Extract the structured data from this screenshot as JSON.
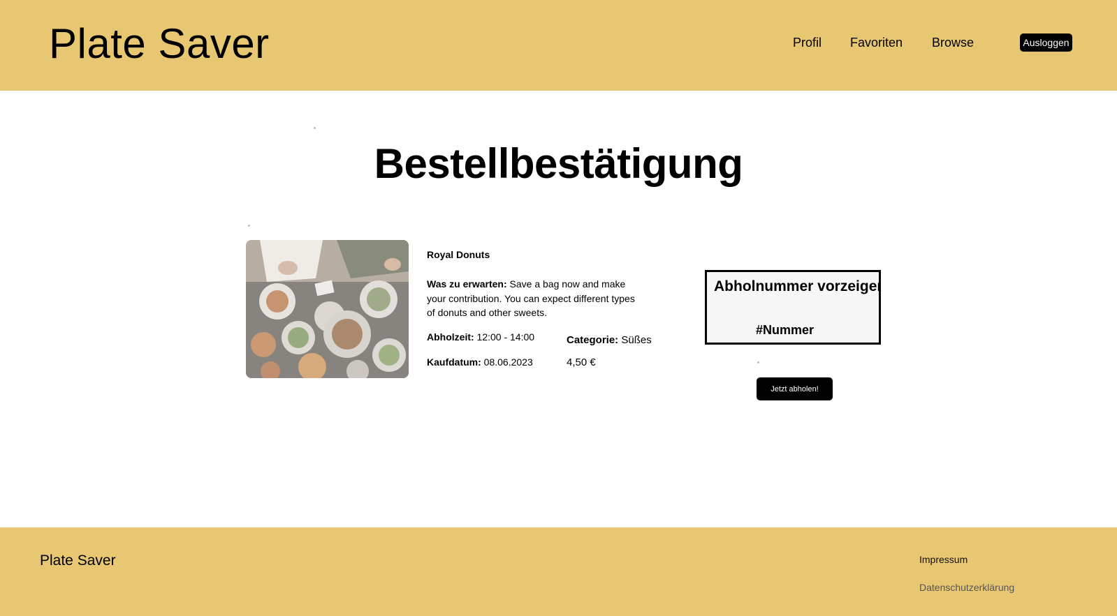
{
  "header": {
    "brand": "Plate Saver",
    "nav": {
      "profil": "Profil",
      "favoriten": "Favoriten",
      "browse": "Browse"
    },
    "logout_label": "Ausloggen"
  },
  "main": {
    "title": "Bestellbestätigung",
    "product": {
      "image_alt": "food-table-photo",
      "shop_name": "Royal Donuts",
      "expect_label": "Was zu erwarten:",
      "expect_text": " Save a bag now and make your contribution. You can expect different types of donuts and other sweets.",
      "pickup_time_label": "Abholzeit:",
      "pickup_time_value": " 12:00 - 14:00",
      "purchase_date_label": "Kaufdatum:",
      "purchase_date_value": " 08.06.2023",
      "category_label": "Categorie:",
      "category_value": " Süßes",
      "price": "4,50 €"
    },
    "pickup": {
      "title": "Abholnummer vorzeigen",
      "number": "#Nummer",
      "button_label": "Jetzt abholen!"
    }
  },
  "footer": {
    "brand": "Plate Saver",
    "links": {
      "impressum": "Impressum",
      "datenschutz": "Datenschutzerklärung"
    }
  },
  "colors": {
    "header_bg": "#e8c773",
    "footer_bg": "#e8c773",
    "button_bg": "#000000"
  }
}
